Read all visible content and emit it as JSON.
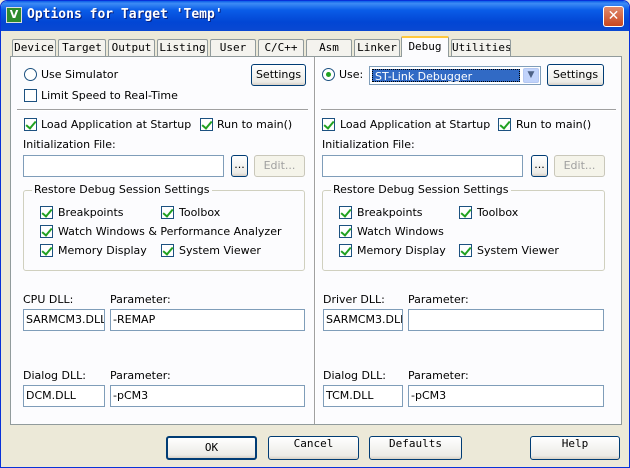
{
  "window": {
    "title": "Options for Target 'Temp'"
  },
  "tabs": [
    "Device",
    "Target",
    "Output",
    "Listing",
    "User",
    "C/C++",
    "Asm",
    "Linker",
    "Debug",
    "Utilities"
  ],
  "active_tab": "Debug",
  "left": {
    "use_simulator": "Use Simulator",
    "limit_speed": "Limit Speed to Real-Time",
    "settings": "Settings",
    "load_app": "Load Application at Startup",
    "run_to_main": "Run to main()",
    "init_file_label": "Initialization File:",
    "init_file_value": "",
    "browse": "...",
    "edit": "Edit...",
    "restore_group": "Restore Debug Session Settings",
    "breakpoints": "Breakpoints",
    "toolbox": "Toolbox",
    "watch": "Watch Windows & Performance Analyzer",
    "memory": "Memory Display",
    "sysview": "System Viewer",
    "cpu_dll_label": "CPU DLL:",
    "cpu_dll_value": "SARMCM3.DLL",
    "cpu_param_label": "Parameter:",
    "cpu_param_value": "-REMAP",
    "dialog_dll_label": "Dialog DLL:",
    "dialog_dll_value": "DCM.DLL",
    "dialog_param_label": "Parameter:",
    "dialog_param_value": "-pCM3"
  },
  "right": {
    "use": "Use:",
    "debugger": "ST-Link Debugger",
    "settings": "Settings",
    "load_app": "Load Application at Startup",
    "run_to_main": "Run to main()",
    "init_file_label": "Initialization File:",
    "init_file_value": "",
    "browse": "...",
    "edit": "Edit...",
    "restore_group": "Restore Debug Session Settings",
    "breakpoints": "Breakpoints",
    "toolbox": "Toolbox",
    "watch": "Watch Windows",
    "memory": "Memory Display",
    "sysview": "System Viewer",
    "driver_dll_label": "Driver DLL:",
    "driver_dll_value": "SARMCM3.DLL",
    "driver_param_label": "Parameter:",
    "driver_param_value": "",
    "dialog_dll_label": "Dialog DLL:",
    "dialog_dll_value": "TCM.DLL",
    "dialog_param_label": "Parameter:",
    "dialog_param_value": "-pCM3"
  },
  "footer": {
    "ok": "OK",
    "cancel": "Cancel",
    "defaults": "Defaults",
    "help": "Help"
  }
}
